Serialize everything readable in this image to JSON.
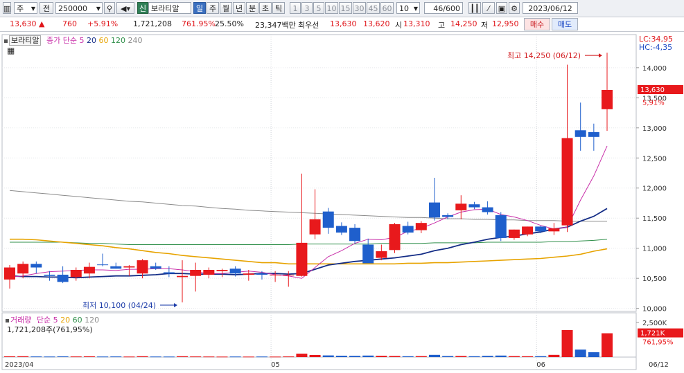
{
  "toolbar": {
    "type_select": "주",
    "prev_button": "전",
    "code": "250000",
    "new_badge": "신",
    "stock_name": "보라티알",
    "period_tabs": [
      "일",
      "주",
      "월",
      "년",
      "분",
      "초",
      "틱"
    ],
    "active_period": "일",
    "minute_options": [
      "1",
      "3",
      "5",
      "10",
      "15",
      "30",
      "45",
      "60"
    ],
    "count_select": "10",
    "count_display": "46/600",
    "date": "2023/06/12"
  },
  "quote": {
    "price": "13,630",
    "change": "760",
    "change_pct": "+5.91%",
    "volume": "1,721,208",
    "volume_ratio": "761.95%",
    "turnover": "25.50%",
    "amount": "23,347백만",
    "best_label": "최우선",
    "ask": "13,630",
    "bid": "13,620",
    "open_label": "시",
    "open": "13,310",
    "high_label": "고",
    "high": "14,250",
    "low_label": "저",
    "low": "12,950",
    "buy_button": "매수",
    "sell_button": "매도"
  },
  "legend": {
    "name": "보라티알",
    "close_label": "종가 단순",
    "ma_periods": [
      "5",
      "20",
      "60",
      "120",
      "240"
    ],
    "volume_label": "거래량",
    "volume_ma_label": "단순",
    "volume_ma_periods": [
      "5",
      "20",
      "60",
      "120"
    ],
    "volume_line": "1,721,208주(761,95%)"
  },
  "indicators": {
    "lc": "LC:34,95",
    "hc": "HC:-4,35"
  },
  "colors": {
    "up": "#e8191c",
    "down": "#1f5fcc",
    "ma5": "#c82ea8",
    "ma20": "#142d86",
    "ma60": "#e7a300",
    "ma120": "#2f8f4a",
    "ma240": "#8a8a8a"
  },
  "chart_data": {
    "type": "candlestick",
    "ylim": [
      9950,
      14550
    ],
    "yticks": [
      10000,
      10500,
      11000,
      11500,
      12000,
      12500,
      13000,
      13500,
      14000
    ],
    "ytick_labels": [
      "10,000",
      "10,500",
      "11,000",
      "11,500",
      "12,000",
      "12,500",
      "13,000",
      "13,500",
      "14,000"
    ],
    "x_labels": [
      {
        "label": "2023/04",
        "index": 0
      },
      {
        "label": "05",
        "index": 20
      },
      {
        "label": "06",
        "index": 40
      },
      {
        "label": "06/12",
        "index": 46
      }
    ],
    "candles": [
      {
        "o": 10480,
        "h": 10720,
        "l": 10330,
        "c": 10680
      },
      {
        "o": 10580,
        "h": 10780,
        "l": 10500,
        "c": 10740
      },
      {
        "o": 10740,
        "h": 10780,
        "l": 10580,
        "c": 10680
      },
      {
        "o": 10560,
        "h": 10620,
        "l": 10460,
        "c": 10540
      },
      {
        "o": 10560,
        "h": 10700,
        "l": 10420,
        "c": 10440
      },
      {
        "o": 10520,
        "h": 10680,
        "l": 10460,
        "c": 10640
      },
      {
        "o": 10580,
        "h": 10760,
        "l": 10500,
        "c": 10690
      },
      {
        "o": 10730,
        "h": 10910,
        "l": 10700,
        "c": 10720
      },
      {
        "o": 10700,
        "h": 10760,
        "l": 10660,
        "c": 10660
      },
      {
        "o": 10680,
        "h": 10720,
        "l": 10540,
        "c": 10700
      },
      {
        "o": 10580,
        "h": 10820,
        "l": 10500,
        "c": 10800
      },
      {
        "o": 10700,
        "h": 10760,
        "l": 10640,
        "c": 10660
      },
      {
        "o": 10600,
        "h": 10700,
        "l": 10520,
        "c": 10580
      },
      {
        "o": 10520,
        "h": 10800,
        "l": 10100,
        "c": 10540
      },
      {
        "o": 10540,
        "h": 10760,
        "l": 10280,
        "c": 10640
      },
      {
        "o": 10560,
        "h": 10680,
        "l": 10500,
        "c": 10640
      },
      {
        "o": 10620,
        "h": 10660,
        "l": 10520,
        "c": 10640
      },
      {
        "o": 10660,
        "h": 10700,
        "l": 10530,
        "c": 10580
      },
      {
        "o": 10560,
        "h": 10640,
        "l": 10460,
        "c": 10580
      },
      {
        "o": 10580,
        "h": 10620,
        "l": 10480,
        "c": 10560
      },
      {
        "o": 10560,
        "h": 10620,
        "l": 10440,
        "c": 10560
      },
      {
        "o": 10560,
        "h": 10620,
        "l": 10360,
        "c": 10560
      },
      {
        "o": 10540,
        "h": 12240,
        "l": 10530,
        "c": 11090
      },
      {
        "o": 11230,
        "h": 11980,
        "l": 11150,
        "c": 11480
      },
      {
        "o": 11610,
        "h": 11670,
        "l": 11240,
        "c": 11340
      },
      {
        "o": 11370,
        "h": 11430,
        "l": 11220,
        "c": 11260
      },
      {
        "o": 11340,
        "h": 11400,
        "l": 11080,
        "c": 11120
      },
      {
        "o": 11060,
        "h": 11160,
        "l": 10790,
        "c": 10750
      },
      {
        "o": 10840,
        "h": 11060,
        "l": 10800,
        "c": 10950
      },
      {
        "o": 10970,
        "h": 11420,
        "l": 10920,
        "c": 11400
      },
      {
        "o": 11370,
        "h": 11440,
        "l": 11230,
        "c": 11260
      },
      {
        "o": 11300,
        "h": 11450,
        "l": 11250,
        "c": 11420
      },
      {
        "o": 11760,
        "h": 12170,
        "l": 11460,
        "c": 11510
      },
      {
        "o": 11550,
        "h": 11580,
        "l": 11480,
        "c": 11520
      },
      {
        "o": 11630,
        "h": 11880,
        "l": 11480,
        "c": 11740
      },
      {
        "o": 11730,
        "h": 11770,
        "l": 11650,
        "c": 11680
      },
      {
        "o": 11680,
        "h": 11780,
        "l": 11560,
        "c": 11600
      },
      {
        "o": 11550,
        "h": 11600,
        "l": 11120,
        "c": 11170
      },
      {
        "o": 11170,
        "h": 11310,
        "l": 11140,
        "c": 11310
      },
      {
        "o": 11230,
        "h": 11360,
        "l": 11200,
        "c": 11360
      },
      {
        "o": 11360,
        "h": 11370,
        "l": 11250,
        "c": 11280
      },
      {
        "o": 11280,
        "h": 11420,
        "l": 11220,
        "c": 11330
      },
      {
        "o": 11380,
        "h": 14050,
        "l": 11270,
        "c": 12830
      },
      {
        "o": 12960,
        "h": 13420,
        "l": 12620,
        "c": 12850
      },
      {
        "o": 12930,
        "h": 13070,
        "l": 12620,
        "c": 12850
      },
      {
        "o": 13310,
        "h": 14250,
        "l": 12950,
        "c": 13630
      }
    ],
    "volumes": [
      55,
      60,
      45,
      40,
      50,
      45,
      55,
      40,
      45,
      38,
      60,
      40,
      38,
      60,
      45,
      40,
      35,
      40,
      35,
      40,
      35,
      45,
      250,
      150,
      120,
      100,
      90,
      110,
      95,
      80,
      60,
      70,
      160,
      75,
      80,
      60,
      90,
      110,
      70,
      60,
      65,
      160,
      1950,
      540,
      350,
      1721
    ],
    "ma5": [
      10520,
      10540,
      10580,
      10610,
      10620,
      10630,
      10640,
      10640,
      10630,
      10650,
      10650,
      10660,
      10660,
      10640,
      10610,
      10580,
      10580,
      10600,
      10620,
      10600,
      10560,
      10540,
      10500,
      10680,
      10860,
      10960,
      11080,
      11150,
      11140,
      11180,
      11280,
      11330,
      11420,
      11520,
      11600,
      11640,
      11650,
      11560,
      11520,
      11460,
      11380,
      11320,
      11350,
      11800,
      12200,
      12700
    ],
    "ma20": [
      10540,
      10530,
      10530,
      10520,
      10520,
      10510,
      10520,
      10530,
      10540,
      10540,
      10550,
      10560,
      10580,
      10580,
      10570,
      10570,
      10570,
      10560,
      10570,
      10580,
      10580,
      10570,
      10580,
      10650,
      10720,
      10750,
      10780,
      10800,
      10820,
      10840,
      10870,
      10900,
      10960,
      11000,
      11060,
      11100,
      11150,
      11180,
      11200,
      11240,
      11270,
      11320,
      11350,
      11450,
      11530,
      11660
    ],
    "ma60": [
      11150,
      11150,
      11140,
      11120,
      11100,
      11080,
      11060,
      11040,
      11010,
      10990,
      10960,
      10930,
      10910,
      10880,
      10860,
      10840,
      10820,
      10800,
      10780,
      10760,
      10760,
      10740,
      10740,
      10740,
      10740,
      10740,
      10740,
      10740,
      10740,
      10740,
      10750,
      10750,
      10760,
      10760,
      10770,
      10780,
      10790,
      10800,
      10810,
      10820,
      10830,
      10850,
      10870,
      10900,
      10950,
      10990
    ],
    "ma120": [
      11100,
      11100,
      11100,
      11100,
      11100,
      11090,
      11080,
      11080,
      11070,
      11060,
      11060,
      11060,
      11060,
      11060,
      11060,
      11060,
      11060,
      11060,
      11060,
      11060,
      11060,
      11060,
      11070,
      11070,
      11070,
      11070,
      11070,
      11070,
      11080,
      11080,
      11080,
      11080,
      11090,
      11090,
      11090,
      11090,
      11100,
      11100,
      11100,
      11100,
      11100,
      11110,
      11110,
      11120,
      11130,
      11150
    ],
    "ma240": [
      11960,
      11940,
      11920,
      11900,
      11880,
      11860,
      11840,
      11820,
      11800,
      11780,
      11770,
      11750,
      11730,
      11710,
      11700,
      11680,
      11660,
      11650,
      11630,
      11620,
      11610,
      11600,
      11590,
      11580,
      11570,
      11560,
      11550,
      11540,
      11530,
      11520,
      11510,
      11510,
      11500,
      11490,
      11490,
      11480,
      11480,
      11470,
      11470,
      11460,
      11460,
      11460,
      11450,
      11450,
      11450,
      11450
    ],
    "annotations": [
      {
        "text": "최고 14,250 (06/12)",
        "index": 45,
        "value": 14250,
        "side": "left"
      },
      {
        "text": "최저 10,100 (04/24)",
        "index": 13,
        "value": 10100,
        "side": "left"
      }
    ],
    "price_tags": [
      {
        "text": "13,630",
        "value": 13630
      },
      {
        "text": "5,91%",
        "value": 13450
      }
    ],
    "volume_axis": {
      "max": 2500,
      "tick_label": "2,500K",
      "tags": [
        "1,721K",
        "761,95%"
      ]
    }
  }
}
